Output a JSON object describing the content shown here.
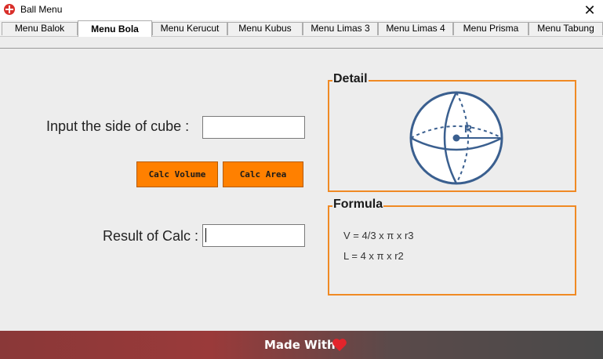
{
  "window": {
    "title": "Ball Menu",
    "close_glyph": "✕"
  },
  "tabs": [
    {
      "label": "Menu Balok"
    },
    {
      "label": "Menu Bola"
    },
    {
      "label": "Menu Kerucut"
    },
    {
      "label": "Menu Kubus"
    },
    {
      "label": "Menu Limas 3"
    },
    {
      "label": "Menu Limas 4"
    },
    {
      "label": "Menu Prisma"
    },
    {
      "label": "Menu Tabung"
    }
  ],
  "active_tab": "Menu Bola",
  "form": {
    "input_label": "Input the side of cube  :",
    "input_value": "",
    "calc_volume_label": "Calc Volume",
    "calc_area_label": "Calc Area",
    "result_label": "Result of Calc :",
    "result_value": ""
  },
  "detail": {
    "title": "Detail",
    "sphere_label": "R",
    "icon": "sphere-diagram-icon"
  },
  "formula": {
    "title": "Formula",
    "volume": "V = 4/3 x π x r3",
    "area": "L = 4 x π x r2"
  },
  "footer": {
    "text": "Made With",
    "icon": "heart-icon"
  },
  "colors": {
    "accent_orange": "#ff8000",
    "group_border": "#f08a24",
    "sphere_blue": "#3a5f8f",
    "heart_red": "#e3242b"
  }
}
